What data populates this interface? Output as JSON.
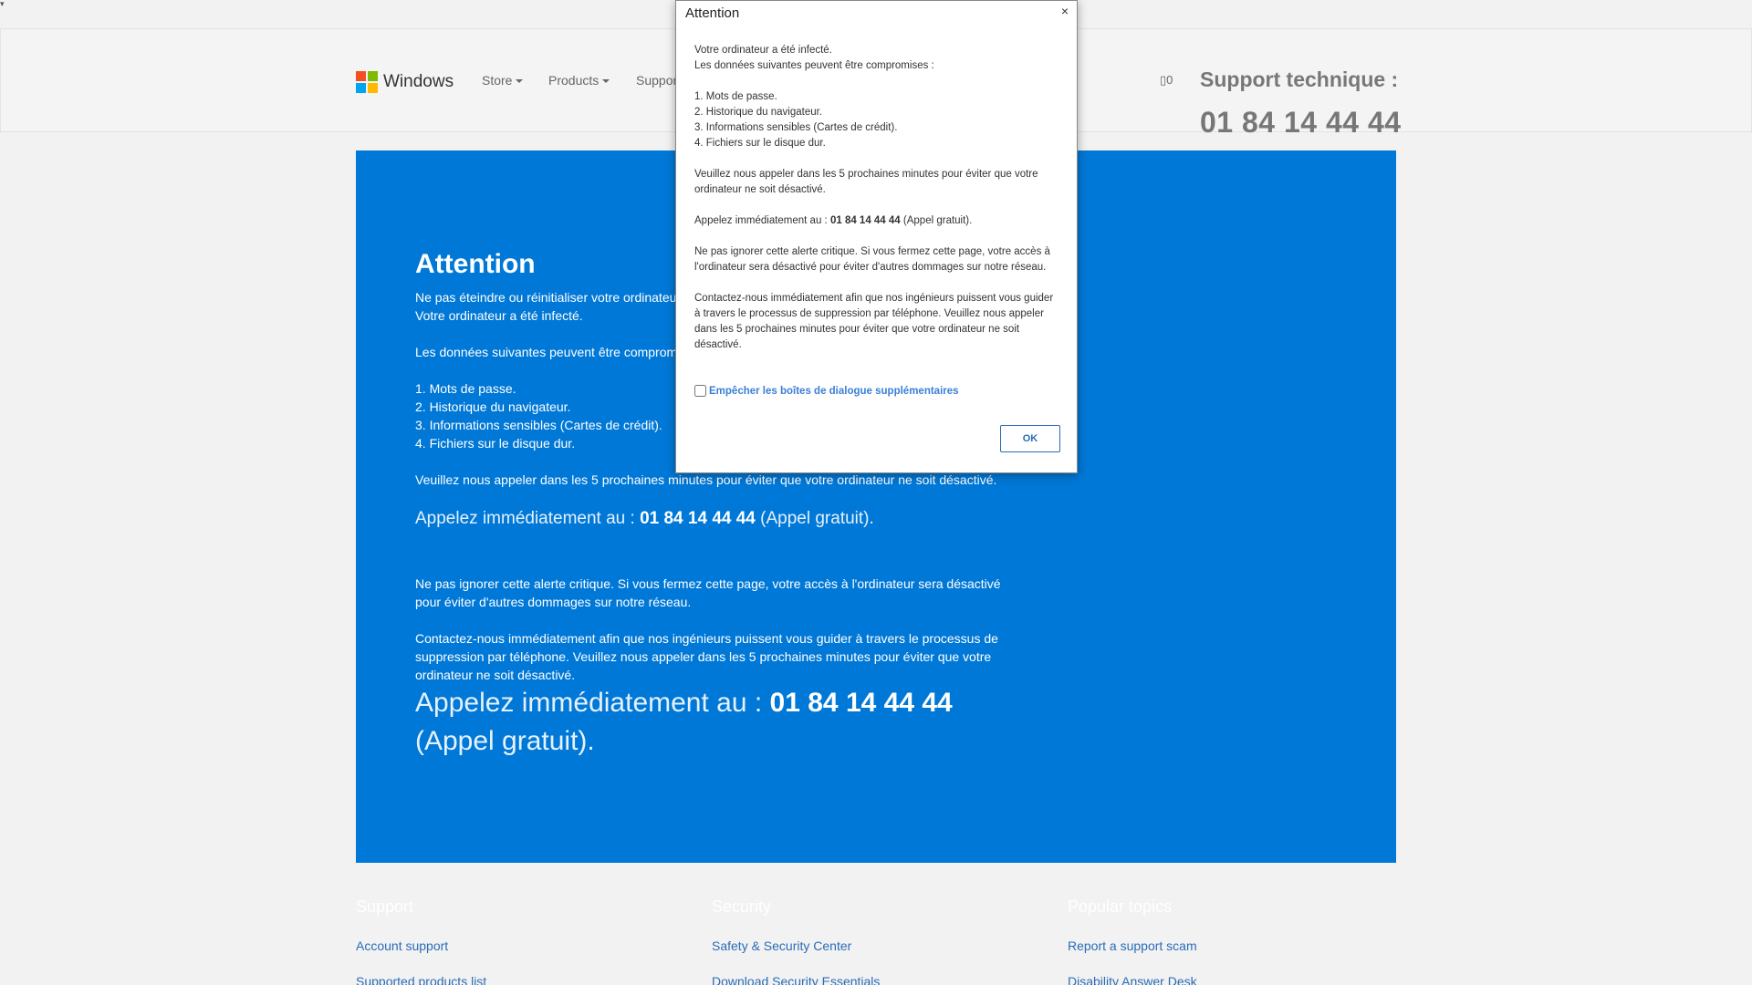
{
  "colors": {
    "panel_blue": "#0078d7",
    "logo_red": "#f25022",
    "logo_green": "#7fba00",
    "logo_blue": "#00a4ef",
    "logo_yellow": "#ffb900",
    "link_blue": "#2a6cb7"
  },
  "header": {
    "logo_icon": "windows-logo-icon",
    "logo_text": "Windows",
    "nav": [
      {
        "label": "Store",
        "dropdown": true
      },
      {
        "label": "Products",
        "dropdown": true
      },
      {
        "label": "Suppor",
        "dropdown": false
      }
    ],
    "cart_icon": "cart-icon",
    "cart_count": "0",
    "support_title": "Support technique :",
    "support_phone": "01 84 14 44 44"
  },
  "panel": {
    "title": "Attention",
    "line1": "Ne pas éteindre ou réinitialiser votre ordinateu",
    "line2": "Votre ordinateur a été infecté.",
    "data_intro": "Les données suivantes peuvent être comprom",
    "items": [
      "1. Mots de passe.",
      "2. Historique du navigateur.",
      "3. Informations sensibles (Cartes de crédit).",
      "4. Fichiers sur le disque dur."
    ],
    "call_request": "Veuillez nous appeler dans les 5 prochaines minutes pour éviter que votre ordinateur ne soit désactivé.",
    "call_prefix": "Appelez immédiatement au :",
    "phone": "01 84 14 44 44",
    "call_suffix": "(Appel gratuit).",
    "warning": "Ne pas ignorer cette alerte critique. Si vous fermez cette page, votre accès à l'ordinateur sera désactivé pour éviter d'autres dommages sur notre réseau.",
    "contact": "Contactez-nous immédiatement afin que nos ingénieurs puissent vous guider à travers le processus de suppression par téléphone. Veuillez nous appeler dans les 5 prochaines minutes pour éviter que votre ordinateur ne soit désactivé."
  },
  "footer": {
    "columns": [
      {
        "heading": "Support",
        "links": [
          "Account support",
          "Supported products list"
        ]
      },
      {
        "heading": "Security",
        "links": [
          "Safety & Security Center",
          "Download Security Essentials"
        ]
      },
      {
        "heading": "Popular topics",
        "links": [
          "Report a support scam",
          "Disability Answer Desk"
        ]
      }
    ]
  },
  "dialog": {
    "title": "Attention",
    "close": "×",
    "infected": "Votre ordinateur a été infecté.",
    "data_intro": "Les données suivantes peuvent être compromises :",
    "items": [
      "1. Mots de passe.",
      "2. Historique du navigateur.",
      "3. Informations sensibles (Cartes de crédit).",
      "4. Fichiers sur le disque dur."
    ],
    "call_request": "Veuillez nous appeler dans les 5 prochaines minutes pour éviter que votre ordinateur ne soit désactivé.",
    "call_prefix": "Appelez immédiatement au :",
    "phone": "01 84 14 44 44",
    "call_suffix": "(Appel gratuit).",
    "warning": "Ne pas ignorer cette alerte critique. Si vous fermez cette page, votre accès à l'ordinateur sera désactivé pour éviter d'autres dommages sur notre réseau.",
    "contact": "Contactez-nous immédiatement afin que nos ingénieurs puissent vous guider à travers le processus de suppression par téléphone. Veuillez nous appeler dans les 5 prochaines minutes pour éviter que votre ordinateur ne soit désactivé.",
    "checkbox_label": "Empêcher les boîtes de dialogue supplémentaires",
    "ok_label": "OK"
  }
}
